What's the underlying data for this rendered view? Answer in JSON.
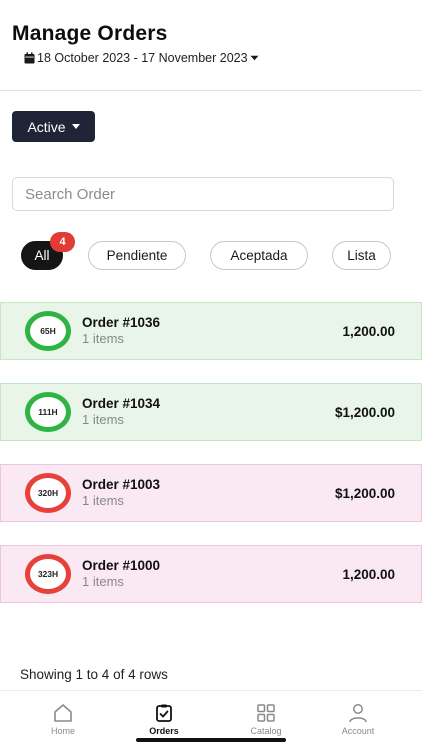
{
  "header": {
    "title": "Manage Orders",
    "date_range": "18 October 2023 - 17 November 2023"
  },
  "status_filter": {
    "label": "Active"
  },
  "search": {
    "placeholder": "Search Order",
    "value": ""
  },
  "filters": {
    "chips": [
      {
        "label": "All",
        "active": true,
        "badge": "4"
      },
      {
        "label": "Pendiente",
        "active": false
      },
      {
        "label": "Aceptada",
        "active": false
      },
      {
        "label": "Lista",
        "active": false
      }
    ]
  },
  "orders": [
    {
      "timer": "65H",
      "name": "Order #1036",
      "items": "1 items",
      "amount": "1,200.00",
      "status_color": "#2db443",
      "bg_color": "#e8f5e8"
    },
    {
      "timer": "111H",
      "name": "Order #1034",
      "items": "1 items",
      "amount": "$1,200.00",
      "status_color": "#2db443",
      "bg_color": "#e8f5e8"
    },
    {
      "timer": "320H",
      "name": "Order #1003",
      "items": "1 items",
      "amount": "$1,200.00",
      "status_color": "#e8403b",
      "bg_color": "#fae8f2"
    },
    {
      "timer": "323H",
      "name": "Order #1000",
      "items": "1 items",
      "amount": "1,200.00",
      "status_color": "#e8403b",
      "bg_color": "#fae8f2"
    }
  ],
  "pagination": {
    "summary": "Showing 1 to 4 of 4 rows"
  },
  "tabbar": {
    "tabs": [
      {
        "label": "Home",
        "icon": "home-icon",
        "active": false
      },
      {
        "label": "Orders",
        "icon": "clipboard-check-icon",
        "active": true
      },
      {
        "label": "Catalog",
        "icon": "grid-icon",
        "active": false
      },
      {
        "label": "Account",
        "icon": "user-icon",
        "active": false
      }
    ]
  },
  "colors": {
    "primary_dark": "#1f2537",
    "badge_red": "#e23a34"
  }
}
